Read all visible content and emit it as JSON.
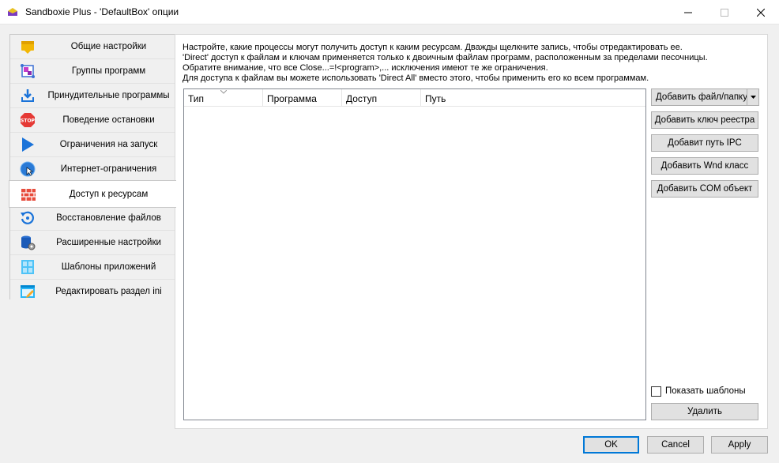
{
  "window": {
    "title": "Sandboxie Plus - 'DefaultBox' опции",
    "icons": {
      "app": "sandboxie-app-icon",
      "minimize": "minimize-icon",
      "maximize": "maximize-icon",
      "close": "close-icon"
    }
  },
  "sidebar": {
    "items": [
      {
        "label": "Общие настройки",
        "icon": "general-settings-icon"
      },
      {
        "label": "Группы программ",
        "icon": "program-groups-icon"
      },
      {
        "label": "Принудительные программы",
        "icon": "forced-programs-icon"
      },
      {
        "label": "Поведение остановки",
        "icon": "stop-icon"
      },
      {
        "label": "Ограничения на запуск",
        "icon": "start-restrictions-icon"
      },
      {
        "label": "Интернет-ограничения",
        "icon": "internet-restrictions-icon"
      },
      {
        "label": "Доступ к ресурсам",
        "icon": "resource-access-icon",
        "active": true
      },
      {
        "label": "Восстановление файлов",
        "icon": "file-recovery-icon"
      },
      {
        "label": "Расширенные настройки",
        "icon": "advanced-settings-icon"
      },
      {
        "label": "Шаблоны приложений",
        "icon": "app-templates-icon"
      },
      {
        "label": "Редактировать раздел ini",
        "icon": "edit-ini-icon"
      }
    ]
  },
  "panel": {
    "description": [
      "Настройте, какие процессы могут получить доступ к каким ресурсам. Дважды щелкните запись, чтобы отредактировать ее.",
      "'Direct' доступ к файлам и ключам применяется только к двоичным файлам программ, расположенным за пределами песочницы.",
      "Обратите внимание, что все Close...=!<program>,... исключения имеют те же ограничения.",
      "Для доступа к файлам вы можете использовать 'Direct All' вместо этого, чтобы применить его ко всем программам."
    ],
    "table": {
      "columns": [
        "Тип",
        "Программа",
        "Доступ",
        "Путь"
      ],
      "rows": []
    },
    "buttons": {
      "add_file": "Добавить файл/папку",
      "add_reg": "Добавить ключ реестра",
      "add_ipc": "Добавит путь IPC",
      "add_wnd": "Добавить Wnd класс",
      "add_com": "Добавить COM объект",
      "remove": "Удалить"
    },
    "show_templates": {
      "label": "Показать шаблоны",
      "checked": false
    }
  },
  "footer": {
    "ok": "OK",
    "cancel": "Cancel",
    "apply": "Apply"
  }
}
